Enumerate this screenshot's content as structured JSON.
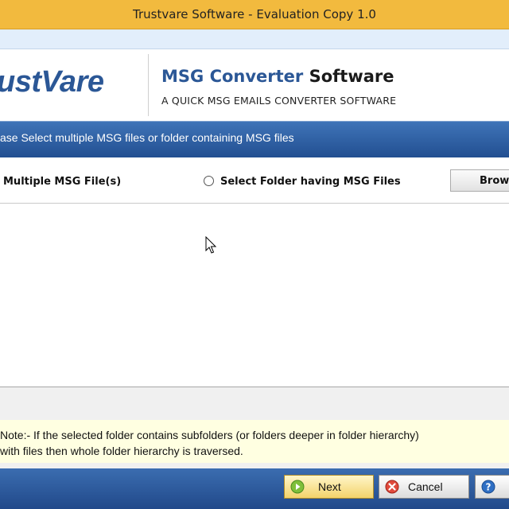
{
  "window": {
    "title": "Trustvare Software - Evaluation Copy 1.0"
  },
  "banner": {
    "logo": "ustVare",
    "product_part1": "MSG Converter ",
    "product_part2": "Software",
    "subtitle": "A QUICK MSG EMAILS CONVERTER SOFTWARE"
  },
  "instruction": "ase Select multiple MSG files or folder containing MSG files",
  "options": {
    "multiple_files": "Multiple MSG File(s)",
    "folder": "Select Folder having MSG Files",
    "browse": "Brows"
  },
  "note": {
    "line1": "Note:- If the selected folder contains subfolders (or folders deeper in folder hierarchy)",
    "line2": "with files then whole folder hierarchy is traversed."
  },
  "footer": {
    "next_label": "Next",
    "cancel_label": "Cancel"
  },
  "icons": {
    "next": "play-arrow-icon",
    "cancel": "cancel-x-icon",
    "help": "help-question-icon",
    "cursor": "mouse-pointer-icon"
  },
  "colors": {
    "title_bar": "#f2ba3e",
    "instruction_bar": "#2f63a6",
    "logo": "#2b5796",
    "note_bg": "#ffffe1"
  }
}
